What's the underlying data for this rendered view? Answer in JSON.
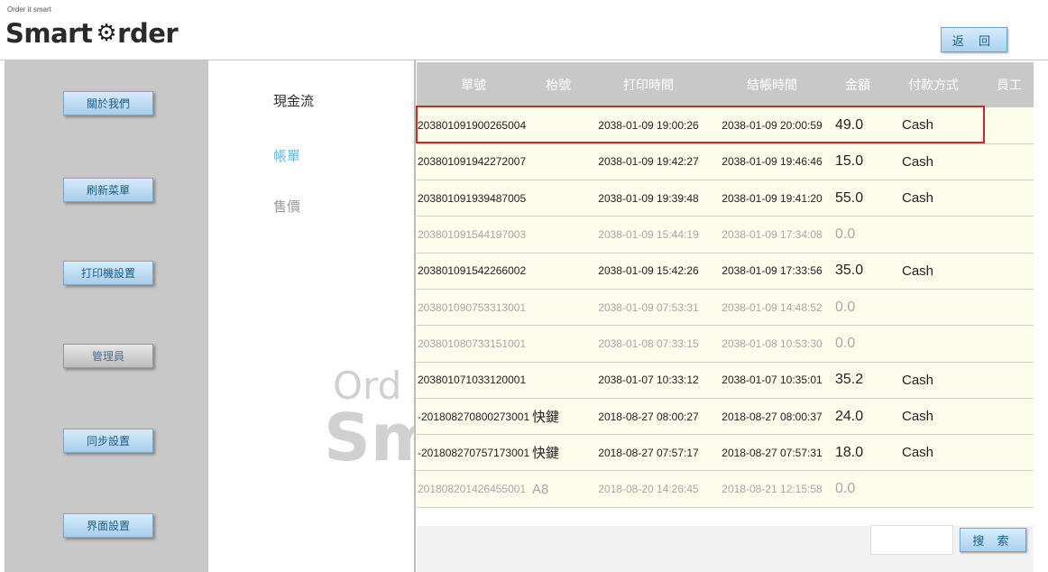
{
  "header": {
    "tagline": "Order it smart",
    "logo_left": "Smart ",
    "logo_right": "rder",
    "back_label": "返 回"
  },
  "sidebar": {
    "items": [
      {
        "label": "關於我們"
      },
      {
        "label": "刷新菜單"
      },
      {
        "label": "打印機設置"
      },
      {
        "label": "管理員"
      },
      {
        "label": "同步設置"
      },
      {
        "label": "界面設置"
      }
    ]
  },
  "middle": {
    "items": [
      {
        "label": "現金流"
      },
      {
        "label": "帳單"
      },
      {
        "label": "售價"
      }
    ],
    "watermark_1": "Ord",
    "watermark_2": "Sm"
  },
  "table": {
    "headers": [
      "單號",
      "枱號",
      "打印時間",
      "結帳時間",
      "金額",
      "付款方式",
      "員工"
    ],
    "rows": [
      {
        "order": "203801091900265004",
        "table": "",
        "print_time": "2038-01-09 19:00:26",
        "checkout_time": "2038-01-09 20:00:59",
        "amount": "49.0",
        "payment": "Cash",
        "staff": ""
      },
      {
        "order": "203801091942272007",
        "table": "",
        "print_time": "2038-01-09 19:42:27",
        "checkout_time": "2038-01-09 19:46:46",
        "amount": "15.0",
        "payment": "Cash",
        "staff": ""
      },
      {
        "order": "203801091939487005",
        "table": "",
        "print_time": "2038-01-09 19:39:48",
        "checkout_time": "2038-01-09 19:41:20",
        "amount": "55.0",
        "payment": "Cash",
        "staff": ""
      },
      {
        "order": "203801091544197003",
        "table": "",
        "print_time": "2038-01-09 15:44:19",
        "checkout_time": "2038-01-09 17:34:08",
        "amount": "0.0",
        "payment": "",
        "staff": ""
      },
      {
        "order": "203801091542266002",
        "table": "",
        "print_time": "2038-01-09 15:42:26",
        "checkout_time": "2038-01-09 17:33:56",
        "amount": "35.0",
        "payment": "Cash",
        "staff": ""
      },
      {
        "order": "203801090753313001",
        "table": "",
        "print_time": "2038-01-09 07:53:31",
        "checkout_time": "2038-01-09 14:48:52",
        "amount": "0.0",
        "payment": "",
        "staff": ""
      },
      {
        "order": "203801080733151001",
        "table": "",
        "print_time": "2038-01-08 07:33:15",
        "checkout_time": "2038-01-08 10:53:30",
        "amount": "0.0",
        "payment": "",
        "staff": ""
      },
      {
        "order": "203801071033120001",
        "table": "",
        "print_time": "2038-01-07 10:33:12",
        "checkout_time": "2038-01-07 10:35:01",
        "amount": "35.2",
        "payment": "Cash",
        "staff": ""
      },
      {
        "order": "-201808270800273001",
        "table": "快鍵",
        "print_time": "2018-08-27 08:00:27",
        "checkout_time": "2018-08-27 08:00:37",
        "amount": "24.0",
        "payment": "Cash",
        "staff": ""
      },
      {
        "order": "-201808270757173001",
        "table": "快鍵",
        "print_time": "2018-08-27 07:57:17",
        "checkout_time": "2018-08-27 07:57:31",
        "amount": "18.0",
        "payment": "Cash",
        "staff": ""
      },
      {
        "order": "201808201426455001",
        "table": "A8",
        "print_time": "2018-08-20 14:26:45",
        "checkout_time": "2018-08-21 12:15:58",
        "amount": "0.0",
        "payment": "",
        "staff": ""
      }
    ]
  },
  "search": {
    "value": "",
    "button_label": "搜 索"
  },
  "colors": {
    "accent": "#a9d2ef",
    "row_bg": "#fdfdec",
    "header_bg": "#c8c8c8",
    "highlight": "#d32626"
  }
}
